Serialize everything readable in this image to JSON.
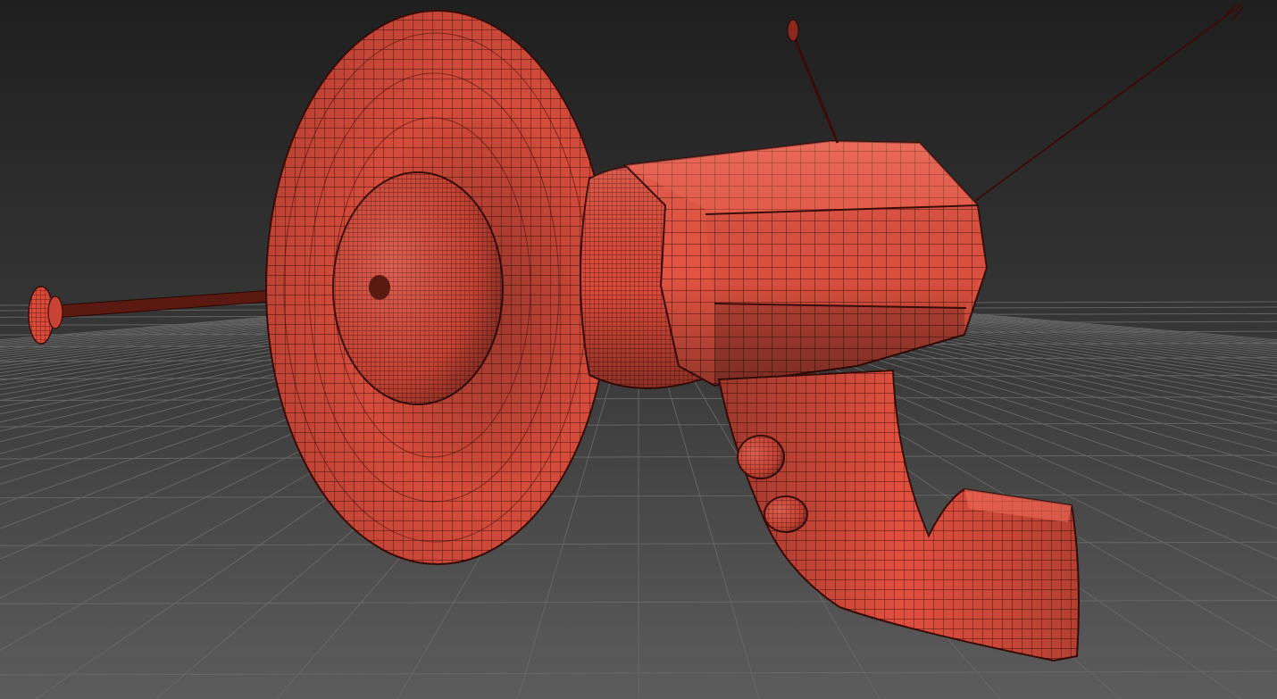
{
  "viewport": {
    "shading_mode": "shaded-with-edged-faces",
    "model_color": "#e0503f",
    "wire_color": "#4a100c",
    "background_top": "#1e1e1e",
    "background_bottom": "#5a5a5a",
    "grid_color": "#6b6b6b",
    "grid_visible": true,
    "model_parts": [
      "rear-antenna-rod",
      "funnel-emitter-dish",
      "dome-hub",
      "neck-coupler",
      "barrel-body",
      "top-antenna",
      "diagonal-antenna",
      "grip-handle",
      "trigger-button-upper",
      "trigger-button-lower"
    ]
  }
}
